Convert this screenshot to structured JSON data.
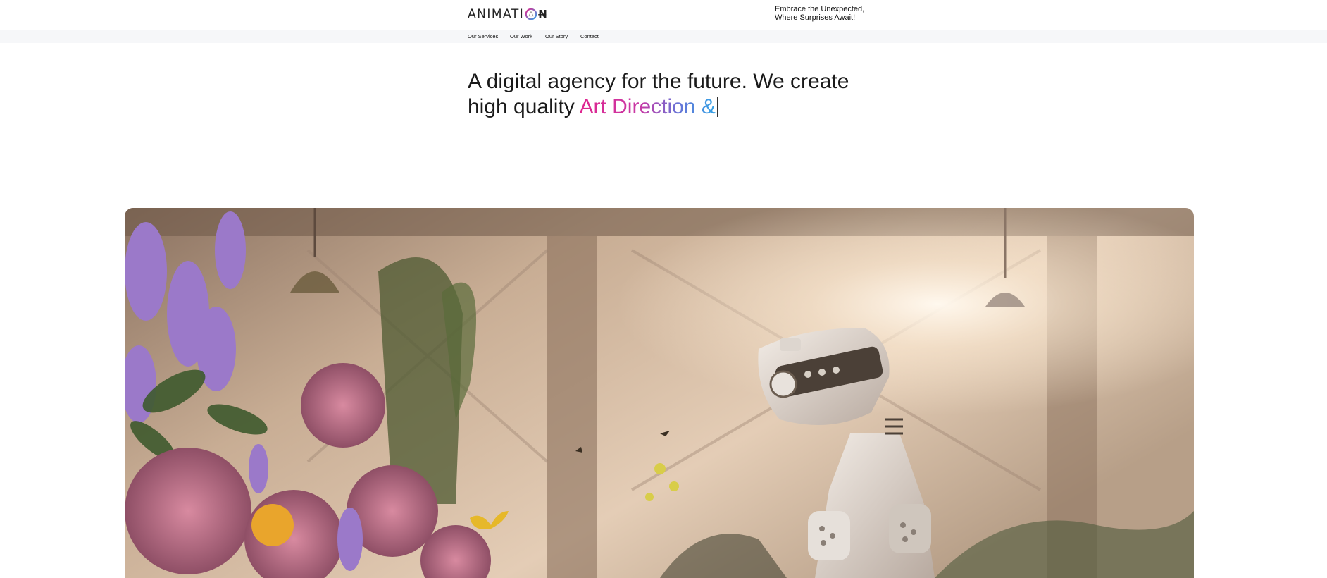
{
  "brand": {
    "logo_text": "ANIMATI",
    "logo_suffix": "N̶"
  },
  "header": {
    "tagline_line1": "Embrace the Unexpected,",
    "tagline_line2": "Where Surprises Await!"
  },
  "nav": {
    "items": [
      {
        "label": "Our Services"
      },
      {
        "label": "Our Work"
      },
      {
        "label": "Our Story"
      },
      {
        "label": "Contact"
      }
    ]
  },
  "hero": {
    "line1": "A digital agency for the future. We create",
    "line2_prefix": "high quality",
    "line2_highlight": "Art Direction &"
  },
  "media": {
    "image_icon": "hero-illustration"
  },
  "colors": {
    "gradient_start": "#e0258f",
    "gradient_end": "#33a3e6",
    "nav_bg": "#f6f7f9"
  }
}
